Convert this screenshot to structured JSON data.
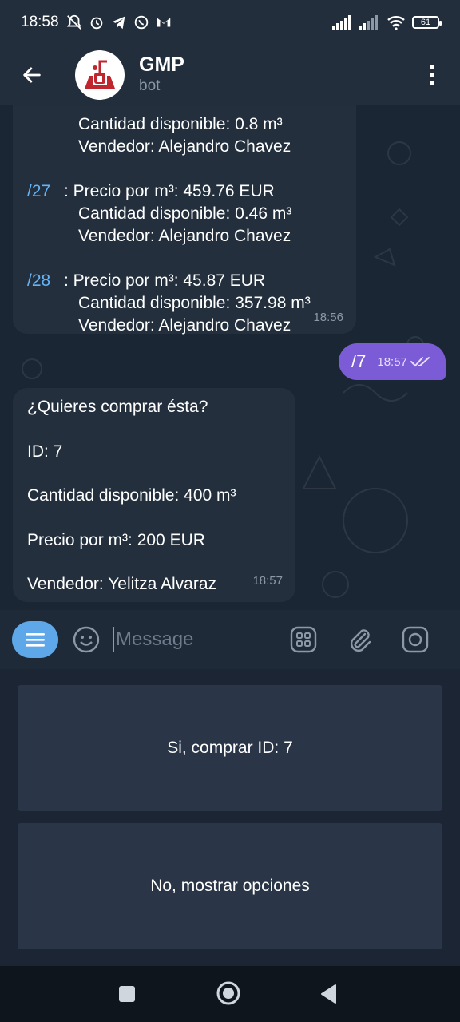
{
  "status_bar": {
    "time": "18:58",
    "battery": "61"
  },
  "header": {
    "title": "GMP",
    "subtitle": "bot"
  },
  "messages": {
    "lot_list": {
      "partial_line_1": "Cantidad disponible: 0.8 m³",
      "partial_line_2": "Vendedor: Alejandro Chavez",
      "lots": [
        {
          "command": "/27",
          "price": "Precio por m³: 459.76 EUR",
          "quantity": "Cantidad disponible: 0.46 m³",
          "seller": "Vendedor: Alejandro Chavez"
        },
        {
          "command": "/28",
          "price": "Precio por m³: 45.87 EUR",
          "quantity": "Cantidad disponible: 357.98 m³",
          "seller": "Vendedor: Alejandro Chavez"
        }
      ],
      "time": "18:56"
    },
    "outgoing": {
      "text": "/7",
      "time": "18:57"
    },
    "confirmation": {
      "question": "¿Quieres comprar ésta?",
      "id": "ID: 7",
      "quantity": "Cantidad disponible: 400 m³",
      "price": "Precio por m³: 200 EUR",
      "seller": "Vendedor: Yelitza Alvaraz",
      "time": "18:57"
    }
  },
  "composer": {
    "placeholder": "Message"
  },
  "reply_keyboard": {
    "buttons": [
      "Si, comprar ID: 7",
      "No, mostrar opciones"
    ]
  },
  "colors": {
    "accent": "#5ea7e8",
    "outgoing_bubble": "#7b5cd6",
    "incoming_bubble": "#232f3d",
    "link": "#64b4f6"
  }
}
